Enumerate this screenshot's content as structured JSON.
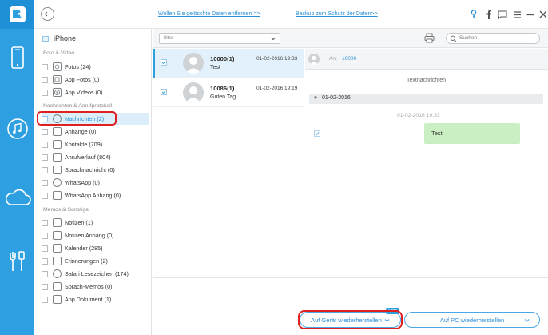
{
  "header": {
    "link_remove": "Wollen Sie gelöschte Daten entfernen >>",
    "link_backup": "Backup zum Schutz der Daten>>"
  },
  "sidebar": {
    "device": "iPhone",
    "sections": [
      {
        "title": "Foto & Video",
        "items": [
          "Fotos (24)",
          "App Fotos (0)",
          "App Videos (0)"
        ]
      },
      {
        "title": "Nachrichten & Anrufprotokoll",
        "items": [
          "Nachrichten (2)",
          "Anhänge (0)",
          "Kontakte (709)",
          "Anrufverlauf (804)",
          "Sprachnachricht (0)",
          "WhatsApp (0)",
          "WhatsApp Anhang (0)"
        ]
      },
      {
        "title": "Memos & Sonstige",
        "items": [
          "Notizen (1)",
          "Notizen Anhang (0)",
          "Kalender (285)",
          "Erinnerungen (2)",
          "Safari Lesezeichen (174)",
          "Sprach-Memos (0)",
          "App Dokument (1)"
        ]
      }
    ]
  },
  "toolbar": {
    "filter_value": "filter",
    "search_placeholder": "Suchen"
  },
  "messages": [
    {
      "name": "10000(1)",
      "date": "01-02-2016 19:33",
      "preview": "Test"
    },
    {
      "name": "10086(1)",
      "date": "01-02-2016 19:19",
      "preview": "Guten Tag"
    }
  ],
  "detail": {
    "an_label": "An:",
    "number": "10000",
    "type_heading": "Textnachrichten",
    "date_group": "01-02-2016",
    "timestamp": "01-02-2016 19:33",
    "bubble_text": "Test"
  },
  "footer": {
    "restore_device": "Auf Gerät wiederherstellen",
    "free_badge": "Free",
    "restore_pc": "Auf PC wiederherstellen"
  },
  "colors": {
    "rail": "#2e9fe0",
    "accent": "#2a8fd6",
    "highlight": "#e02020",
    "bubble": "#c9efc2"
  }
}
